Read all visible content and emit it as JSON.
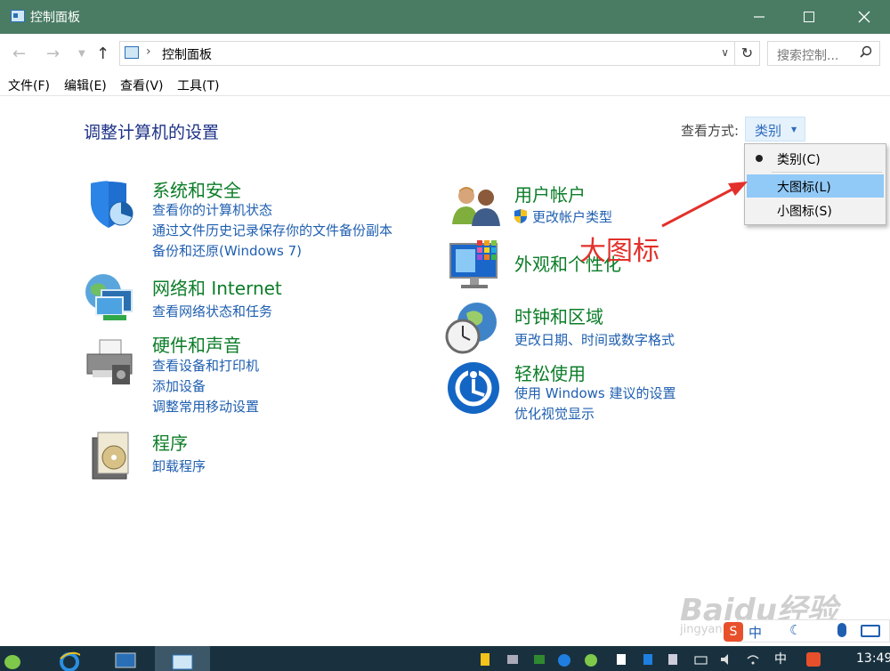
{
  "window": {
    "title": "控制面板"
  },
  "address": {
    "crumb": "控制面板",
    "search_placeholder": "搜索控制..."
  },
  "menubar": {
    "file": "文件(F)",
    "edit": "编辑(E)",
    "view": "查看(V)",
    "tools": "工具(T)"
  },
  "content": {
    "heading": "调整计算机的设置",
    "view_label": "查看方式:",
    "view_value": "类别"
  },
  "dropdown": {
    "items": [
      {
        "label": "类别(C)",
        "selected": true
      },
      {
        "label": "大图标(L)",
        "highlighted": true
      },
      {
        "label": "小图标(S)"
      }
    ]
  },
  "annotation": {
    "text": "大图标",
    "color": "#e3302b"
  },
  "categories": {
    "system": {
      "title": "系统和安全",
      "links": [
        "查看你的计算机状态",
        "通过文件历史记录保存你的文件备份副本",
        "备份和还原(Windows 7)"
      ]
    },
    "network": {
      "title": "网络和 Internet",
      "links": [
        "查看网络状态和任务"
      ]
    },
    "hardware": {
      "title": "硬件和声音",
      "links": [
        "查看设备和打印机",
        "添加设备",
        "调整常用移动设置"
      ]
    },
    "programs": {
      "title": "程序",
      "links": [
        "卸载程序"
      ]
    },
    "users": {
      "title": "用户帐户",
      "links": [
        "更改帐户类型"
      ]
    },
    "appearance": {
      "title": "外观和个性化",
      "links": []
    },
    "clock": {
      "title": "时钟和区域",
      "links": [
        "更改日期、时间或数字格式"
      ]
    },
    "ease": {
      "title": "轻松使用",
      "links": [
        "使用 Windows 建议的设置",
        "优化视觉显示"
      ]
    }
  },
  "watermark": {
    "line1": "Baidu经验",
    "line2": "jingyan.baidu.com"
  },
  "taskbar": {
    "ime_lang": "中",
    "clock": "13:49"
  },
  "colors": {
    "titlebar": "#4a7c64",
    "link": "#1f5fb0",
    "category_title": "#0c7d28",
    "heading": "#1e3287",
    "taskbar": "#19313f"
  }
}
